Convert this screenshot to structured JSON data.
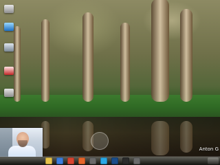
{
  "desktop": {
    "icons": [
      {
        "icon": "recycle-bin-icon"
      },
      {
        "icon": "computer-icon"
      },
      {
        "icon": "folder-icon"
      },
      {
        "icon": "computer-network-icon"
      },
      {
        "icon": "drive-icon"
      }
    ]
  },
  "overlay": {
    "username": "Anton G"
  },
  "taskbar": {
    "icons": [
      {
        "icon": "file-explorer-icon",
        "color": "#e6c24a"
      },
      {
        "icon": "store-icon",
        "color": "#3b7ddd"
      },
      {
        "icon": "chrome-icon",
        "color": "#d9432f"
      },
      {
        "icon": "firefox-icon",
        "color": "#e6652a"
      },
      {
        "icon": "app-icon",
        "color": "#6a6a6a"
      },
      {
        "icon": "skype-icon",
        "color": "#2aa8e6"
      },
      {
        "icon": "photoshop-icon",
        "color": "#1a4d8a"
      },
      {
        "icon": "terminal-icon",
        "color": "#2b2b2b"
      },
      {
        "icon": "app-icon",
        "color": "#6a6a6a"
      }
    ]
  }
}
